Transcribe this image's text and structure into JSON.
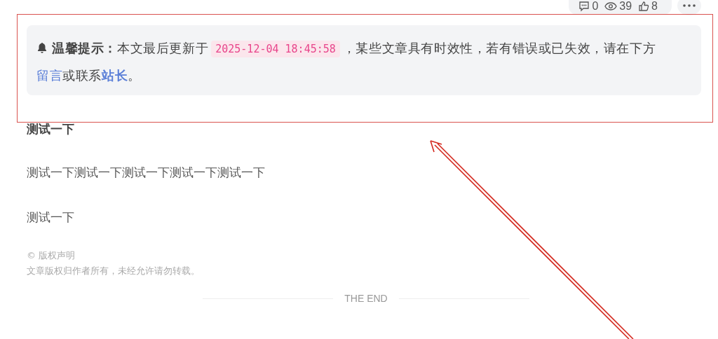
{
  "stats": {
    "comments": "0",
    "views": "39",
    "likes": "8"
  },
  "notice": {
    "label": "温馨提示：",
    "text_before": "本文最后更新于",
    "date": "2025-12-04 18:45:58",
    "text_after": "，某些文章具有时效性，若有错误或已失效，请在下方",
    "link_comment": "留言",
    "middle": "或联系",
    "link_admin": "站长",
    "end": "。"
  },
  "content": [
    {
      "kind": "heading",
      "text": "测试一下"
    },
    {
      "kind": "paragraph",
      "text": "测试一下测试一下测试一下测试一下测试一下"
    },
    {
      "kind": "paragraph",
      "text": "测试一下"
    }
  ],
  "copyright": {
    "title": "© 版权声明",
    "text": "文章版权归作者所有，未经允许请勿转载。"
  },
  "end_divider": "THE END"
}
